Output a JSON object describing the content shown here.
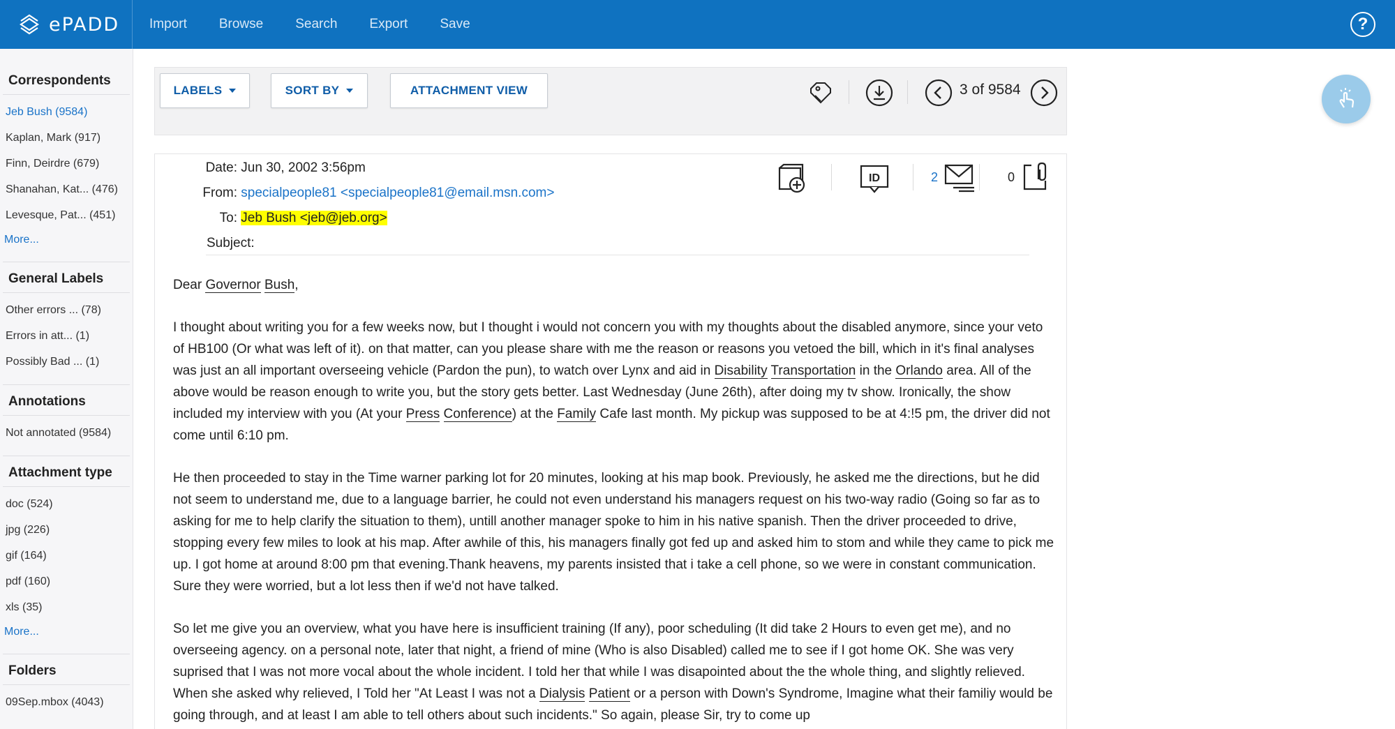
{
  "brand": {
    "name": "ePADD"
  },
  "nav": {
    "items": [
      "Import",
      "Browse",
      "Search",
      "Export",
      "Save"
    ]
  },
  "sidebar": {
    "sections": [
      {
        "title": "Correspondents",
        "items": [
          "Jeb Bush (9584)",
          "Kaplan, Mark (917)",
          "Finn, Deirdre (679)",
          "Shanahan, Kat... (476)",
          "Levesque, Pat... (451)"
        ],
        "more": "More..."
      },
      {
        "title": "General Labels",
        "items": [
          "Other errors ... (78)",
          "Errors in att... (1)",
          "Possibly Bad ... (1)"
        ]
      },
      {
        "title": "Annotations",
        "items": [
          "Not annotated (9584)"
        ]
      },
      {
        "title": "Attachment type",
        "items": [
          "doc (524)",
          "jpg (226)",
          "gif (164)",
          "pdf (160)",
          "xls (35)"
        ],
        "more": "More..."
      },
      {
        "title": "Folders",
        "items": [
          "09Sep.mbox (4043)"
        ]
      }
    ]
  },
  "toolbar": {
    "labels_button": "LABELS",
    "sortby_button": "SORT BY",
    "attachment_view_button": "ATTACHMENT VIEW",
    "pager_text": "3 of 9584"
  },
  "message": {
    "date_label": "Date:",
    "date": "Jun 30, 2002 3:56pm",
    "from_label": "From:",
    "from": "specialpeople81 <specialpeople81@email.msn.com>",
    "to_label": "To:",
    "to": "Jeb Bush <jeb@jeb.org>",
    "subject_label": "Subject:",
    "subject": "",
    "thread_count": "2",
    "attachment_count": "0",
    "body": {
      "greeting_1": "Dear ",
      "greeting_e1": "Governor",
      "greeting_2": " ",
      "greeting_e2": "Bush",
      "greeting_3": ",",
      "p1_a": "I thought about writing you for a few weeks now, but I thought i would not concern you with my thoughts about the disabled anymore, since your veto of HB100 (Or what was left of it). on that matter, can you please share with me the reason or reasons you vetoed the bill, which in it's final analyses was just an all important overseeing vehicle (Pardon the pun), to watch over Lynx and aid in ",
      "p1_e1": "Disability",
      "p1_b": " ",
      "p1_e2": "Transportation",
      "p1_c": " in the ",
      "p1_e3": "Orlando",
      "p1_d": " area. All of the above would be reason enough to write you, but the story gets better. Last Wednesday (June 26th), after doing my tv show. Ironically, the show included my interview with you (At your ",
      "p1_e4": "Press",
      "p1_e": " ",
      "p1_e5": "Conference",
      "p1_f": ") at the ",
      "p1_e6": "Family",
      "p1_g": " Cafe last month. My pickup was supposed to be at 4:!5 pm, the driver did not come until 6:10 pm.",
      "p2": "He then proceeded to stay in the Time warner parking lot for 20 minutes, looking at his map book. Previously, he asked me the directions, but he did not seem to understand me, due to a language barrier, he could not even understand his managers request on his two-way radio (Going so far as to asking for me to help clarify the situation to them), untill another manager spoke to him in his native spanish. Then the driver proceeded to drive, stopping every few miles to look at his map. After awhile of this, his managers finally got fed up and asked him to stom and while they came to pick me up. I got home at around 8:00 pm that evening.Thank heavens, my parents insisted that i take a cell phone, so we were in constant communication. Sure they were worried, but a lot less then if we'd not have talked.",
      "p3_a": "So let me give you an overview, what you have here is insufficient training (If any), poor scheduling (It did take 2 Hours to even get me), and no overseeing agency. on a personal note, later that night, a friend of mine (Who is also Disabled) called me to see if I got home OK. She was very suprised that I was not more vocal about the whole incident. I told her that while I was disapointed about the the whole thing, and slightly relieved. When she asked why relieved, I Told her \"At Least I was not a ",
      "p3_e1": "Dialysis",
      "p3_b": " ",
      "p3_e2": "Patient",
      "p3_c": " or a person with Down's Syndrome, Imagine what their familiy would be going through, and at least I am able to tell others about such incidents.\" So again, please Sir, try to come up"
    }
  },
  "colors": {
    "topbar": "#0f72c0",
    "link": "#1a73c8",
    "highlight": "#ffff00",
    "fab": "#9bcbea"
  },
  "icons": [
    "epadd-logo-icon",
    "help-icon",
    "tag-icon",
    "download-icon",
    "chevron-left-icon",
    "chevron-right-icon",
    "add-to-collection-icon",
    "id-card-icon",
    "mail-thread-icon",
    "attachment-icon",
    "touch-icon"
  ]
}
